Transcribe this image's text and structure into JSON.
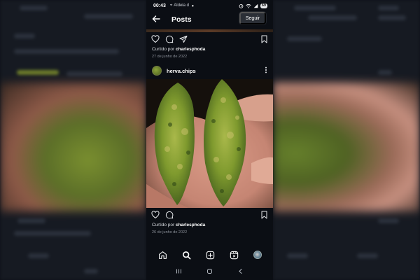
{
  "status_bar": {
    "time": "00:43",
    "location": "Aldeia d",
    "battery": "69"
  },
  "header": {
    "title": "Posts",
    "follow_label": "Seguir"
  },
  "posts": [
    {
      "liked_by_prefix": "Curtido por",
      "liked_by_user": "charlesphoda",
      "date": "27 de junho de 2022"
    },
    {
      "username": "herva.chips",
      "liked_by_prefix": "Curtido por",
      "liked_by_user": "charlesphoda",
      "date": "26 de junho de 2022"
    }
  ],
  "icons": {
    "like": "heart-icon",
    "comment": "comment-icon",
    "share": "send-icon",
    "save": "bookmark-icon",
    "home": "home-icon",
    "search": "search-icon",
    "create": "plus-square-icon",
    "reels": "reels-icon",
    "profile": "avatar"
  },
  "colors": {
    "background": "#0b0e14",
    "text": "#e8eaed",
    "secondary_text": "#8b9099",
    "follow_button": "#2b2f36"
  }
}
